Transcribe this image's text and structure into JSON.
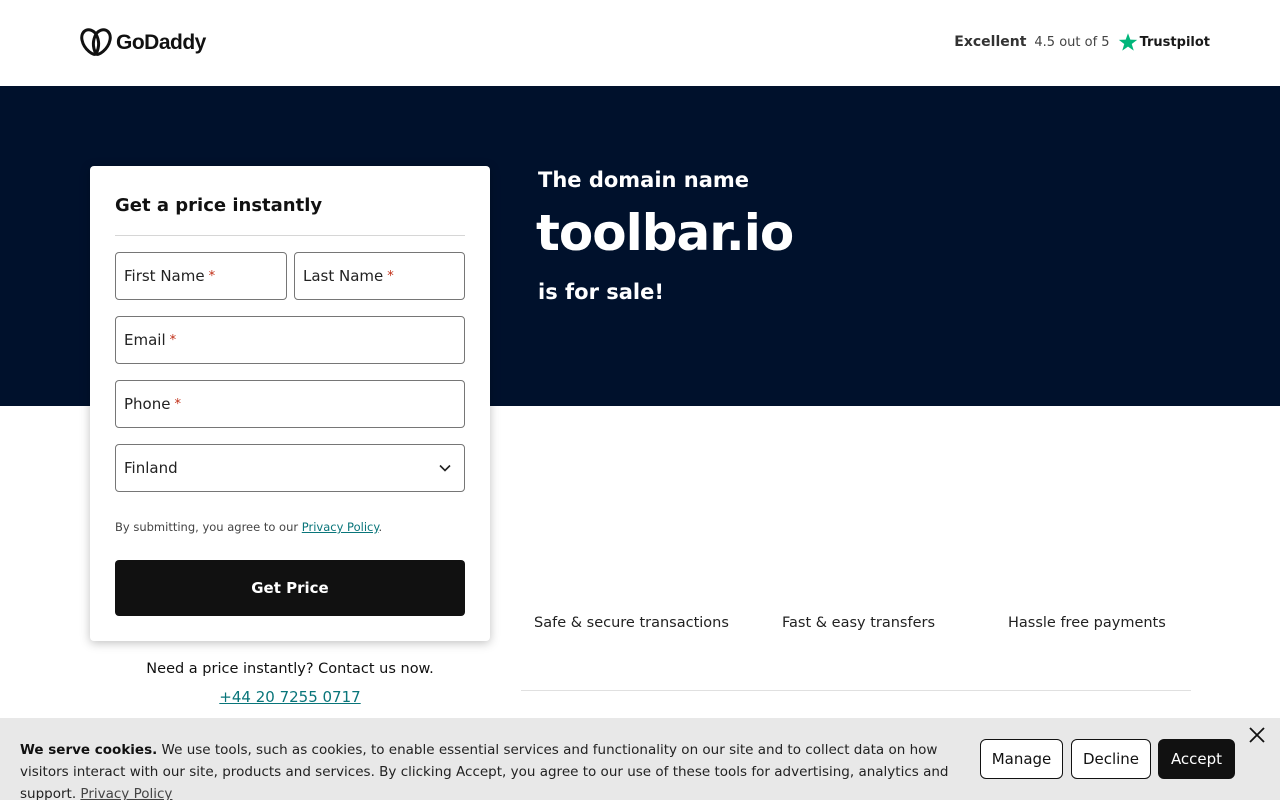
{
  "header": {
    "logo_text": "GoDaddy",
    "trust_rating": "Excellent",
    "trust_score": "4.5 out of 5",
    "trust_brand": "Trustpilot",
    "trust_color": "#00b67a"
  },
  "hero": {
    "pre": "The domain name",
    "domain": "toolbar.io",
    "post": "is for sale!",
    "background": "#00112c"
  },
  "form": {
    "title": "Get a price instantly",
    "first_name_label": "First Name",
    "last_name_label": "Last Name",
    "email_label": "Email",
    "phone_label": "Phone",
    "required_mark": "*",
    "country_value": "Finland",
    "disclaimer_prefix": "By submitting, you agree to our ",
    "disclaimer_link": "Privacy Policy",
    "disclaimer_suffix": ".",
    "submit_label": "Get Price"
  },
  "contact": {
    "text": "Need a price instantly? Contact us now.",
    "phone": "+44 20 7255 0717"
  },
  "features": [
    {
      "label": "Safe & secure transactions"
    },
    {
      "label": "Fast & easy transfers"
    },
    {
      "label": "Hassle free payments"
    }
  ],
  "cookie": {
    "title": "We serve cookies.",
    "body": " We use tools, such as cookies, to enable essential services and functionality on our site and to collect data on how visitors interact with our site, products and services. By clicking Accept, you agree to our use of these tools for advertising, analytics and support. ",
    "policy_link": "Privacy Policy",
    "manage_label": "Manage",
    "decline_label": "Decline",
    "accept_label": "Accept"
  },
  "icons": {
    "logo": "godaddy-logo-icon",
    "star": "star-icon",
    "chevron": "chevron-down-icon",
    "close": "close-icon"
  }
}
